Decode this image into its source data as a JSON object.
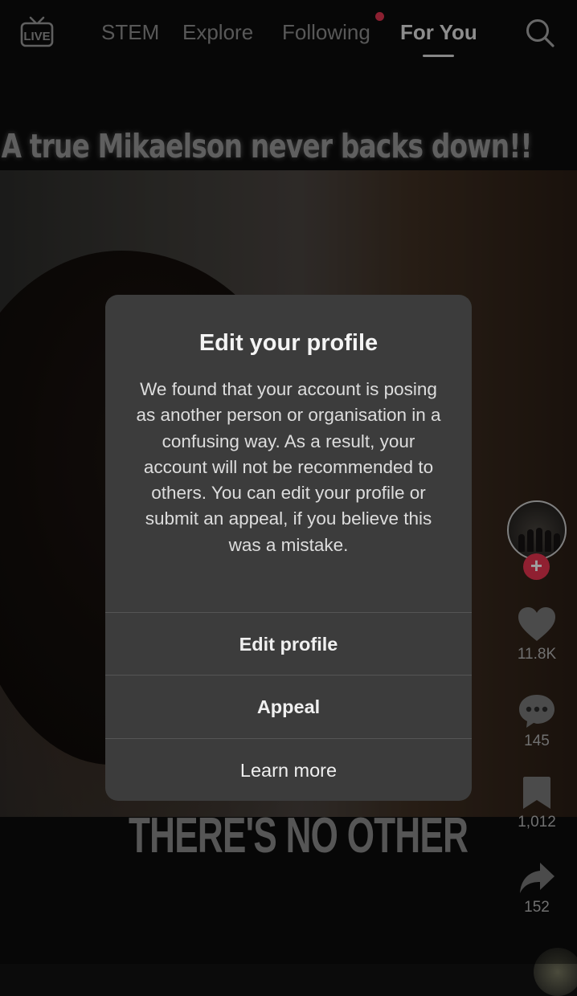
{
  "nav": {
    "live_label": "LIVE",
    "tabs": [
      {
        "label": "STEM",
        "active": false
      },
      {
        "label": "Explore",
        "active": false
      },
      {
        "label": "Following",
        "active": false,
        "notification_dot": true
      },
      {
        "label": "For You",
        "active": true
      }
    ],
    "icons": {
      "left": "live-tv-icon",
      "right": "search-icon"
    }
  },
  "video": {
    "caption_top": "A true Mikaelson never backs down!!",
    "caption_bottom": "THERE'S NO OTHER"
  },
  "dialog": {
    "title": "Edit your profile",
    "body": "We found that your account is posing as another person or organisation in a confusing way. As a result, your account will not be recommended to others. You can edit your profile or submit an appeal, if you believe this was a mistake.",
    "buttons": {
      "edit_profile": "Edit profile",
      "appeal": "Appeal",
      "learn_more": "Learn more"
    }
  },
  "actions": {
    "likes": "11.8K",
    "comments": "145",
    "saves": "1,012",
    "shares": "152",
    "follow_symbol": "+"
  },
  "colors": {
    "accent": "#e8344f",
    "dialog_bg": "#3c3c3c",
    "tab_active": "#e4e4e4",
    "tab_inactive": "#8f8f8f"
  }
}
